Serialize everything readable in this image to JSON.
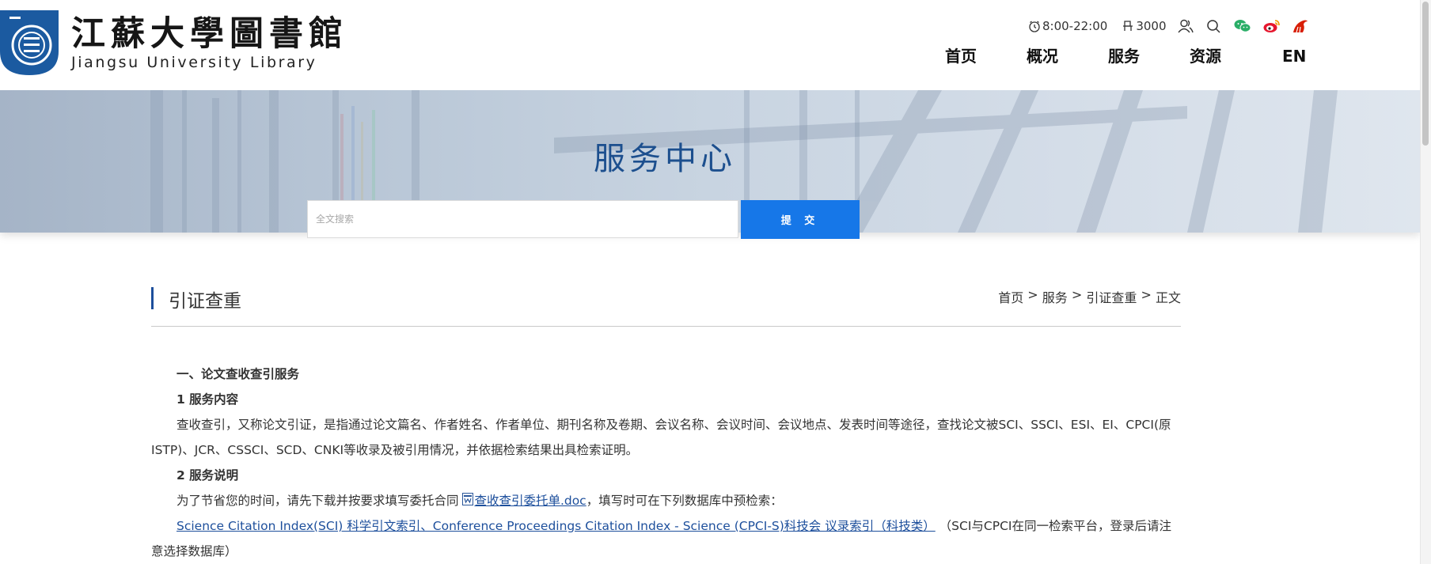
{
  "header": {
    "logo_cn": "江蘇大學圖書館",
    "logo_en": "Jiangsu University Library",
    "hours": "8:00-22:00",
    "seats": "3000",
    "icons": [
      "clock-icon",
      "seat-icon",
      "user-icon",
      "search-icon",
      "wechat-icon",
      "weibo-icon",
      "library-mascot-icon"
    ],
    "colors": {
      "wechat": "#2aae67",
      "weibo": "#e6162d",
      "mascot": "#d81e06"
    }
  },
  "nav": {
    "items": [
      "首页",
      "概况",
      "服务",
      "资源",
      "EN"
    ]
  },
  "banner": {
    "title": "服务中心",
    "search_placeholder": "全文搜索",
    "submit_label": "提 交"
  },
  "section": {
    "title": "引证查重",
    "breadcrumb": [
      "首页",
      "服务",
      "引证查重",
      "正文"
    ],
    "breadcrumb_sep": " > "
  },
  "article": {
    "h1": "一、论文查收查引服务",
    "h2_1": "1 服务内容",
    "p1": "查收查引，又称论文引证，是指通过论文篇名、作者姓名、作者单位、期刊名称及卷期、会议名称、会议时间、会议地点、发表时间等途径，查找论文被SCI、SSCI、ESI、EI、CPCI(原ISTP)、JCR、CSSCI、SCD、CNKI等收录及被引用情况，并依据检索结果出具检索证明。",
    "h2_2": "2 服务说明",
    "p2_before": "为了节省您的时间，请先下载并按要求填写委托合同 ",
    "p2_link": "查收查引委托单.doc",
    "p2_after": "，填写时可在下列数据库中预检索：",
    "p3_link": "Science Citation Index(SCI) 科学引文索引、Conference Proceedings Citation Index - Science (CPCI-S)科技会 议录索引（科技类）",
    "p3_after": " （SCI与CPCI在同一检索平台，登录后请注意选择数据库）"
  },
  "colors": {
    "accent": "#1d4f9c",
    "button": "#1677e8",
    "banner_title": "#1c4f8e"
  }
}
